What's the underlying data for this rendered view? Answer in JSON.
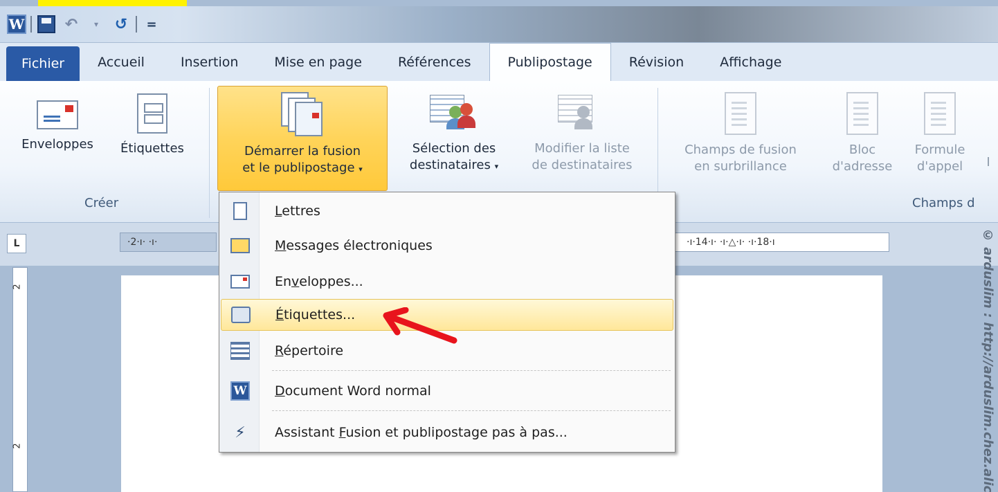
{
  "qat": {
    "word_letter": "W",
    "customize_glyph": "=",
    "undo_icon": "undo-icon",
    "redo_icon": "redo-icon",
    "save_icon": "save-icon"
  },
  "tabs": [
    {
      "label": "Fichier"
    },
    {
      "label": "Accueil"
    },
    {
      "label": "Insertion"
    },
    {
      "label": "Mise en page"
    },
    {
      "label": "Références"
    },
    {
      "label": "Publipostage"
    },
    {
      "label": "Révision"
    },
    {
      "label": "Affichage"
    }
  ],
  "ribbon": {
    "groups": {
      "creer": "Créer",
      "champs": "Champs d"
    },
    "enveloppes": "Enveloppes",
    "etiquettes": "Étiquettes",
    "demarrer_line1": "Démarrer la fusion",
    "demarrer_line2": "et le publipostage",
    "selection_line1": "Sélection des",
    "selection_line2": "destinataires",
    "modifier_line1": "Modifier la liste",
    "modifier_line2": "de destinataires",
    "champs_line1": "Champs de fusion",
    "champs_line2": "en surbrillance",
    "bloc_line1": "Bloc",
    "bloc_line2": "d'adresse",
    "formule_line1": "Formule",
    "formule_line2": "d'appel",
    "cut_letter": "I"
  },
  "ruler": {
    "corner": "L",
    "left_marks": "·2·ı·  ·ı·",
    "right_marks": "·ı·14·ı·  ·ı·△·ı·  ·ı·18·ı",
    "v_marks": [
      "2",
      "2"
    ]
  },
  "menu": {
    "items": [
      {
        "pre": "",
        "key": "L",
        "post": "ettres"
      },
      {
        "pre": "",
        "key": "M",
        "post": "essages électroniques"
      },
      {
        "pre": "En",
        "key": "v",
        "post": "eloppes..."
      },
      {
        "pre": "",
        "key": "É",
        "post": "tiquettes..."
      },
      {
        "pre": "",
        "key": "R",
        "post": "épertoire"
      },
      {
        "pre": "",
        "key": "D",
        "post": "ocument Word normal"
      },
      {
        "pre": "Assistant ",
        "key": "F",
        "post": "usion et publipostage pas à pas..."
      }
    ],
    "hovered_index": 3
  },
  "colors": {
    "file_tab": "#2a5aa6",
    "pressed": "#ffd45a",
    "arrow": "#e8141c",
    "highlight": "#fff200"
  },
  "watermark": "© arduslim : http://arduslim.chez.alice.fr"
}
